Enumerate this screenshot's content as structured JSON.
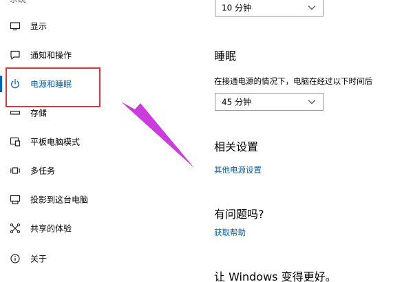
{
  "sidebar": {
    "header": "系统",
    "items": [
      {
        "label": "显示",
        "icon": "monitor-icon"
      },
      {
        "label": "通知和操作",
        "icon": "notification-icon"
      },
      {
        "label": "电源和睡眠",
        "icon": "power-icon",
        "active": true
      },
      {
        "label": "存储",
        "icon": "storage-icon"
      },
      {
        "label": "平板电脑模式",
        "icon": "tablet-mode-icon"
      },
      {
        "label": "多任务",
        "icon": "multitasking-icon"
      },
      {
        "label": "投影到这台电脑",
        "icon": "project-icon"
      },
      {
        "label": "共享的体验",
        "icon": "shared-experience-icon"
      },
      {
        "label": "关于",
        "icon": "info-icon"
      }
    ]
  },
  "main": {
    "screen_dropdown_value": "10 分钟",
    "sleep": {
      "title": "睡眠",
      "description": "在接通电源的情况下，电脑在经过以下时间后",
      "dropdown_value": "45 分钟"
    },
    "related": {
      "title": "相关设置",
      "link": "其他电源设置"
    },
    "question": {
      "title": "有问题吗?",
      "link": "获取帮助"
    },
    "improve": {
      "title": "让 Windows 变得更好。"
    }
  },
  "colors": {
    "accent": "#0063b1",
    "annotation_box": "#e2323a",
    "annotation_arrow": "#cc3bde"
  }
}
